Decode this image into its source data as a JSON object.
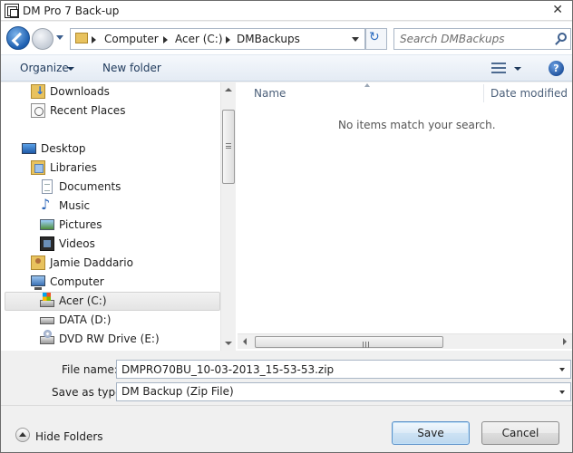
{
  "window": {
    "title": "DM Pro 7 Back-up",
    "close_glyph": "✕"
  },
  "address": {
    "breadcrumbs": [
      "Computer",
      "Acer (C:)",
      "DMBackups"
    ],
    "search_placeholder": "Search DMBackups",
    "refresh_glyph": "↻"
  },
  "toolbar": {
    "organize_label": "Organize",
    "new_folder_label": "New folder",
    "help_glyph": "?"
  },
  "sidebar": {
    "items": [
      {
        "label": "Downloads",
        "icon": "downloads-icon"
      },
      {
        "label": "Recent Places",
        "icon": "recent-places-icon"
      },
      {
        "label": "Desktop",
        "icon": "desktop-icon"
      },
      {
        "label": "Libraries",
        "icon": "libraries-icon"
      },
      {
        "label": "Documents",
        "icon": "documents-icon"
      },
      {
        "label": "Music",
        "icon": "music-icon"
      },
      {
        "label": "Pictures",
        "icon": "pictures-icon"
      },
      {
        "label": "Videos",
        "icon": "videos-icon"
      },
      {
        "label": "Jamie Daddario",
        "icon": "user-folder-icon"
      },
      {
        "label": "Computer",
        "icon": "computer-icon"
      },
      {
        "label": "Acer (C:)",
        "icon": "drive-c-icon",
        "selected": true
      },
      {
        "label": "DATA (D:)",
        "icon": "drive-icon"
      },
      {
        "label": "DVD RW Drive (E:)",
        "icon": "dvd-drive-icon"
      }
    ]
  },
  "file_list": {
    "columns": [
      "Name",
      "Date modified"
    ],
    "empty_message": "No items match your search."
  },
  "form": {
    "file_name_label": "File name:",
    "file_name_value": "DMPRO70BU_10-03-2013_15-53-53.zip",
    "save_type_label": "Save as type:",
    "save_type_value": "DM Backup (Zip File)"
  },
  "footer": {
    "hide_folders_label": "Hide Folders",
    "save_label": "Save",
    "cancel_label": "Cancel"
  },
  "colors": {
    "accent": "#2c6cc0",
    "toolbar_text": "#1e395b",
    "save_border": "#5b91c9"
  }
}
